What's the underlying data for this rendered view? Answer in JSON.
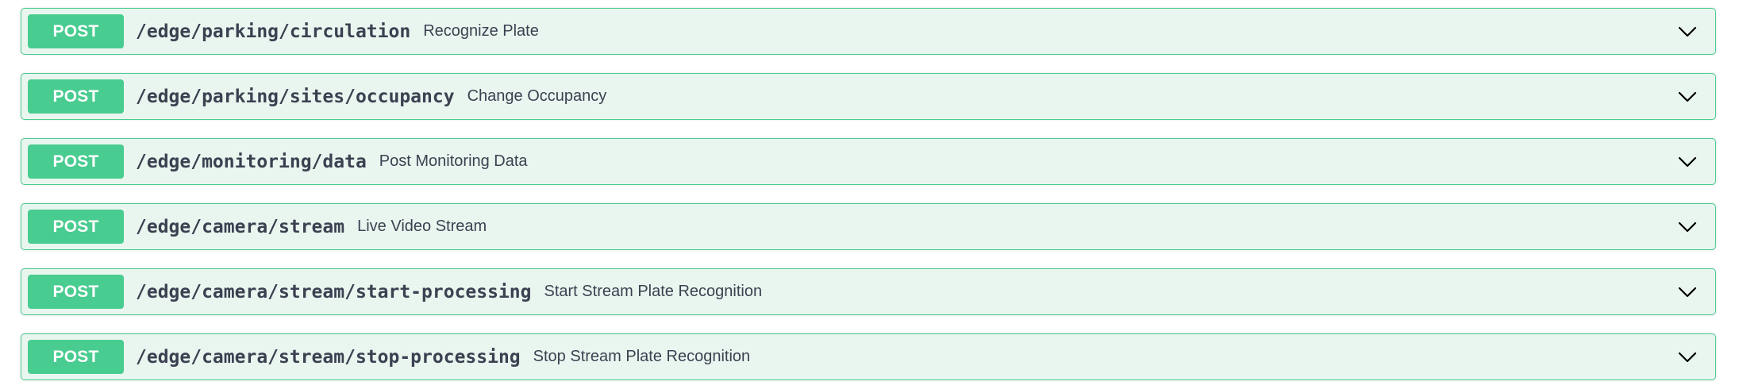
{
  "operations": [
    {
      "method": "POST",
      "path": "/edge/parking/circulation",
      "summary": "Recognize Plate",
      "icon": "chevron-down-icon"
    },
    {
      "method": "POST",
      "path": "/edge/parking/sites/occupancy",
      "summary": "Change Occupancy",
      "icon": "chevron-down-icon"
    },
    {
      "method": "POST",
      "path": "/edge/monitoring/data",
      "summary": "Post Monitoring Data",
      "icon": "chevron-down-icon"
    },
    {
      "method": "POST",
      "path": "/edge/camera/stream",
      "summary": "Live Video Stream",
      "icon": "chevron-down-icon"
    },
    {
      "method": "POST",
      "path": "/edge/camera/stream/start-processing",
      "summary": "Start Stream Plate Recognition",
      "icon": "chevron-down-icon"
    },
    {
      "method": "POST",
      "path": "/edge/camera/stream/stop-processing",
      "summary": "Stop Stream Plate Recognition",
      "icon": "chevron-down-icon"
    }
  ],
  "colors": {
    "post_accent": "#49cc90",
    "post_background": "#e9f6ef",
    "text": "#3b4151"
  }
}
